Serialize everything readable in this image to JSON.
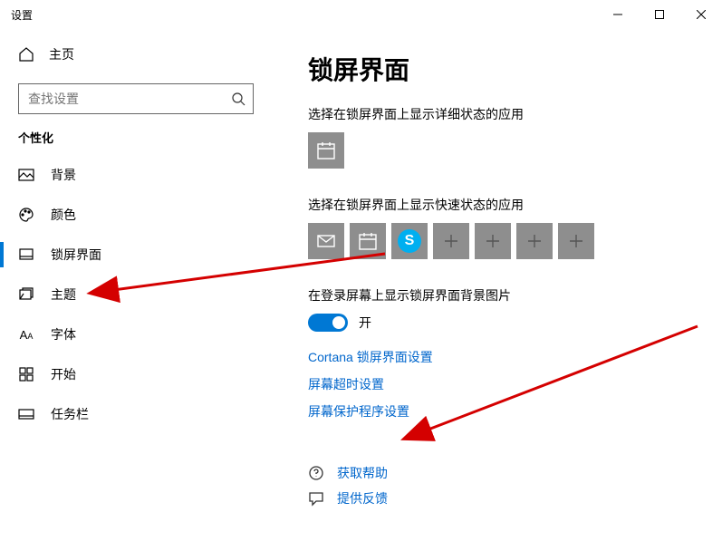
{
  "window": {
    "title": "设置"
  },
  "home_label": "主页",
  "search": {
    "placeholder": "查找设置"
  },
  "section_label": "个性化",
  "nav": [
    {
      "label": "背景"
    },
    {
      "label": "颜色"
    },
    {
      "label": "锁屏界面"
    },
    {
      "label": "主题"
    },
    {
      "label": "字体"
    },
    {
      "label": "开始"
    },
    {
      "label": "任务栏"
    }
  ],
  "page": {
    "title": "锁屏界面",
    "detail_status_label": "选择在锁屏界面上显示详细状态的应用",
    "quick_status_label": "选择在锁屏界面上显示快速状态的应用",
    "signin_bg_label": "在登录屏幕上显示锁屏界面背景图片",
    "toggle_on": "开",
    "links": {
      "cortana": "Cortana 锁屏界面设置",
      "timeout": "屏幕超时设置",
      "screensaver": "屏幕保护程序设置"
    },
    "help": "获取帮助",
    "feedback": "提供反馈"
  }
}
